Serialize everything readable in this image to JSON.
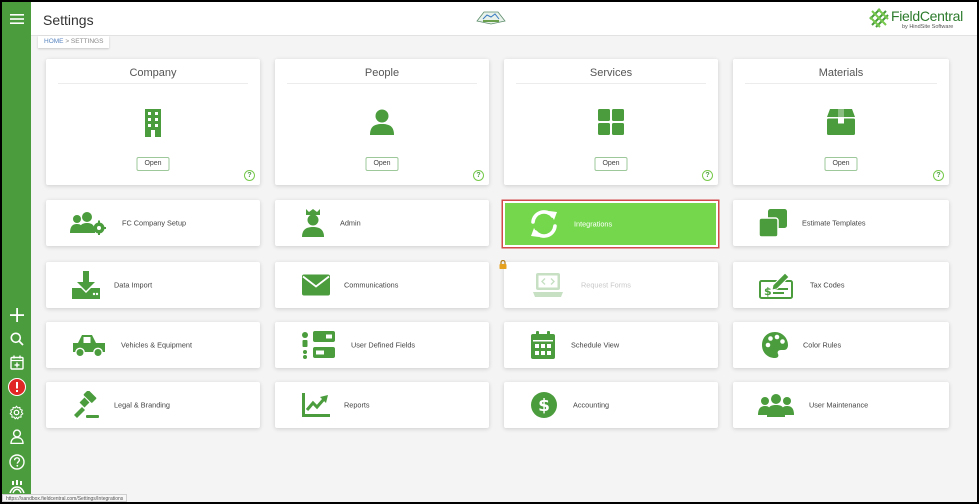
{
  "page": {
    "title": "Settings"
  },
  "breadcrumb": {
    "home": "HOME",
    "separator": ">",
    "current": "SETTINGS"
  },
  "brand": {
    "name": "FieldCentral",
    "sub": "by HindSite Software",
    "accent": "#4a9c3c",
    "tile_active": "#75d84c"
  },
  "sidebar": {
    "items": [
      {
        "name": "menu",
        "icon": "hamburger-icon"
      },
      {
        "name": "add",
        "icon": "plus-icon"
      },
      {
        "name": "search",
        "icon": "search-icon"
      },
      {
        "name": "calendar-add",
        "icon": "calendar-plus-icon"
      },
      {
        "name": "alerts",
        "icon": "alert-icon"
      },
      {
        "name": "settings",
        "icon": "gear-icon"
      },
      {
        "name": "profile",
        "icon": "user-icon"
      },
      {
        "name": "help",
        "icon": "help-icon"
      },
      {
        "name": "apps",
        "icon": "app-logo-icon"
      }
    ]
  },
  "cards": [
    {
      "title": "Company",
      "open": "Open",
      "help": "?",
      "icon": "building-icon"
    },
    {
      "title": "People",
      "open": "Open",
      "help": "?",
      "icon": "person-icon"
    },
    {
      "title": "Services",
      "open": "Open",
      "help": "?",
      "icon": "grid-icon"
    },
    {
      "title": "Materials",
      "open": "Open",
      "help": "?",
      "icon": "box-icon"
    }
  ],
  "tiles": [
    {
      "label": "FC Company Setup",
      "icon": "users-gear-icon"
    },
    {
      "label": "Admin",
      "icon": "admin-user-icon"
    },
    {
      "label": "Integrations",
      "icon": "sync-icon",
      "state": "active"
    },
    {
      "label": "Estimate Templates",
      "icon": "copy-icon"
    },
    {
      "label": "Data Import",
      "icon": "download-icon"
    },
    {
      "label": "Communications",
      "icon": "envelope-icon"
    },
    {
      "label": "Request Forms",
      "icon": "laptop-code-icon",
      "state": "disabled"
    },
    {
      "label": "Tax Codes",
      "icon": "money-check-edit-icon"
    },
    {
      "label": "Vehicles & Equipment",
      "icon": "truck-icon"
    },
    {
      "label": "User Defined Fields",
      "icon": "list-form-icon"
    },
    {
      "label": "Schedule View",
      "icon": "calendar-icon"
    },
    {
      "label": "Color Rules",
      "icon": "palette-icon"
    },
    {
      "label": "Legal & Branding",
      "icon": "gavel-icon"
    },
    {
      "label": "Reports",
      "icon": "chart-line-icon"
    },
    {
      "label": "Accounting",
      "icon": "dollar-circle-icon"
    },
    {
      "label": "User Maintenance",
      "icon": "users-icon"
    }
  ],
  "status_url": "https://sandbox.fieldcentral.com/Settings/Integrations"
}
